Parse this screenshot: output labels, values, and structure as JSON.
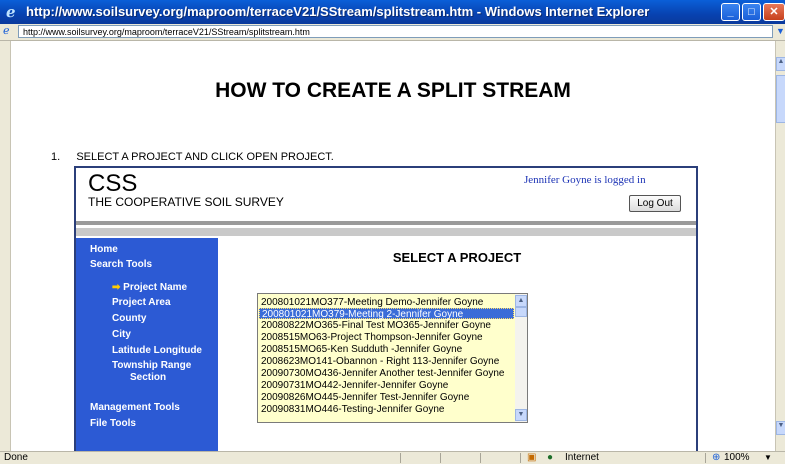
{
  "window": {
    "title": "http://www.soilsurvey.org/maproom/terraceV21/SStream/splitstream.htm - Windows Internet Explorer",
    "address": "http://www.soilsurvey.org/maproom/terraceV21/SStream/splitstream.htm",
    "icon_names": [
      "ie-icon",
      "minimize-icon",
      "maximize-icon",
      "close-icon"
    ]
  },
  "page": {
    "heading": "HOW TO CREATE A SPLIT STREAM",
    "step_number": "1.",
    "step_text": "SELECT A PROJECT AND CLICK OPEN PROJECT."
  },
  "app": {
    "logo": "CSS",
    "logo_subtitle": "THE COOPERATIVE SOIL SURVEY",
    "logged_in_text": "Jennifer Goyne is logged in",
    "logout_label": "Log Out",
    "panel_title": "SELECT A PROJECT",
    "sidebar": {
      "home": "Home",
      "search_tools": "Search Tools",
      "project_name": "Project Name",
      "project_area": "Project Area",
      "county": "County",
      "city": "City",
      "latitude_longitude": "Latitude Longitude",
      "township_range_1": "Township Range",
      "township_range_2": "Section",
      "management_tools": "Management Tools",
      "file_tools": "File Tools"
    },
    "projects": [
      "200801021MO377-Meeting Demo-Jennifer Goyne",
      "200801021MO379-Meeting 2-Jennifer Goyne",
      "20080822MO365-Final Test MO365-Jennifer Goyne",
      "2008515MO63-Project Thompson-Jennifer Goyne",
      "2008515MO65-Ken Sudduth -Jennifer Goyne",
      "2008623MO141-Obannon - Right 113-Jennifer Goyne",
      "20090730MO436-Jennifer Another test-Jennifer Goyne",
      "20090731MO442-Jennifer-Jennifer Goyne",
      "20090826MO445-Jennifer Test-Jennifer Goyne",
      "20090831MO446-Testing-Jennifer Goyne"
    ],
    "selected_project": "200801021MO379-Meeting 2-Jennifer Goyne",
    "colors": {
      "sidebar": "#2c5ad4",
      "listbox": "#ffffcc",
      "selection": "#3a6cd8",
      "arrow": "#ffcc00"
    }
  },
  "status": {
    "left": "Done",
    "zone": "Internet",
    "zoom": "100%"
  }
}
